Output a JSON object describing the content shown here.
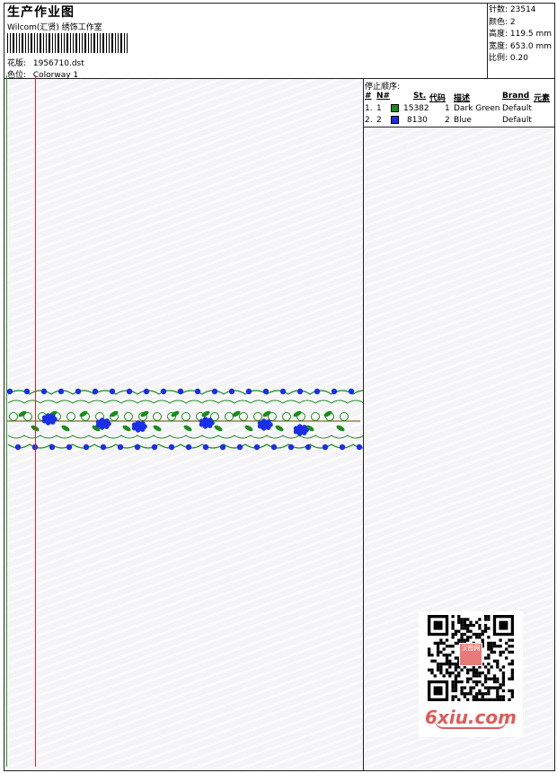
{
  "header": {
    "title": "生产作业图",
    "studio": "Wilcom(汇贤) 绣饰工作室",
    "pattern_label": "花版:",
    "pattern_value": "1956710.dst",
    "color_label": "色位:",
    "color_value": "Colorway 1"
  },
  "specs": [
    "针数: 23514",
    "颜色: 2",
    "高度: 119.5 mm",
    "宽度: 653.0 mm",
    "比例: 0.20"
  ],
  "stop_sequence": {
    "title": "停止顺序:",
    "headers": {
      "hash": "#",
      "no": "N#",
      "st": "St.",
      "code": "代码",
      "desc": "描述",
      "brand": "Brand",
      "elem": "元素"
    },
    "rows": [
      {
        "idx": "1.",
        "no": "1",
        "color": "#1a8c1a",
        "st": "15382",
        "code": "1",
        "desc": "Dark Green",
        "brand": "Default"
      },
      {
        "idx": "2.",
        "no": "2",
        "color": "#1a2ee8",
        "st": "8130",
        "code": "2",
        "desc": "Blue",
        "brand": "Default"
      }
    ]
  },
  "design": {
    "green": "#1a8c1a",
    "blue": "#1a2ee8",
    "guide_green": "#2a9a2a",
    "guide_red": "#e0242a"
  },
  "watermark": {
    "seal_text": "汉图网",
    "site": "6xiu.com"
  }
}
